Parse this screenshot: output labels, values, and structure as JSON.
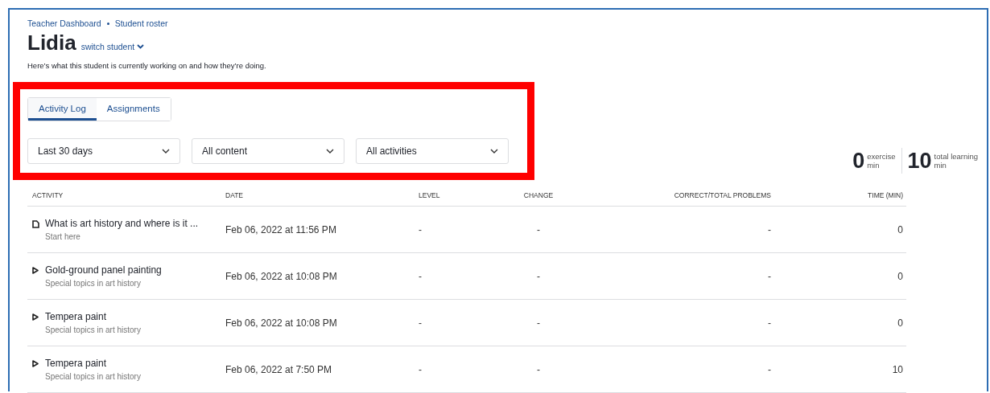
{
  "breadcrumbs": [
    "Teacher Dashboard",
    "Student roster"
  ],
  "student": {
    "name": "Lidia",
    "switch_label": "switch student"
  },
  "description": "Here’s what this student is currently working on and how they’re doing.",
  "tabs": [
    {
      "label": "Activity Log",
      "selected": true
    },
    {
      "label": "Assignments",
      "selected": false
    }
  ],
  "filters": [
    {
      "value": "Last 30 days"
    },
    {
      "value": "All content"
    },
    {
      "value": "All activities"
    }
  ],
  "stats": [
    {
      "value": "0",
      "label_top": "exercise",
      "label_bottom": "min"
    },
    {
      "value": "10",
      "label_top": "total learning",
      "label_bottom": "min"
    }
  ],
  "table": {
    "columns": [
      "ACTIVITY",
      "DATE",
      "LEVEL",
      "CHANGE",
      "CORRECT/TOTAL PROBLEMS",
      "TIME (MIN)"
    ],
    "rows": [
      {
        "kind": "article",
        "title": "What is art history and where is it ...",
        "subtitle": "Start here",
        "date": "Feb 06, 2022 at 11:56 PM",
        "level": "-",
        "change": "-",
        "correct_total": "-",
        "time": "0"
      },
      {
        "kind": "video",
        "title": "Gold-ground panel painting",
        "subtitle": "Special topics in art history",
        "date": "Feb 06, 2022 at 10:08 PM",
        "level": "-",
        "change": "-",
        "correct_total": "-",
        "time": "0"
      },
      {
        "kind": "video",
        "title": "Tempera paint",
        "subtitle": "Special topics in art history",
        "date": "Feb 06, 2022 at 10:08 PM",
        "level": "-",
        "change": "-",
        "correct_total": "-",
        "time": "0"
      },
      {
        "kind": "video",
        "title": "Tempera paint",
        "subtitle": "Special topics in art history",
        "date": "Feb 06, 2022 at 7:50 PM",
        "level": "-",
        "change": "-",
        "correct_total": "-",
        "time": "10"
      }
    ]
  }
}
